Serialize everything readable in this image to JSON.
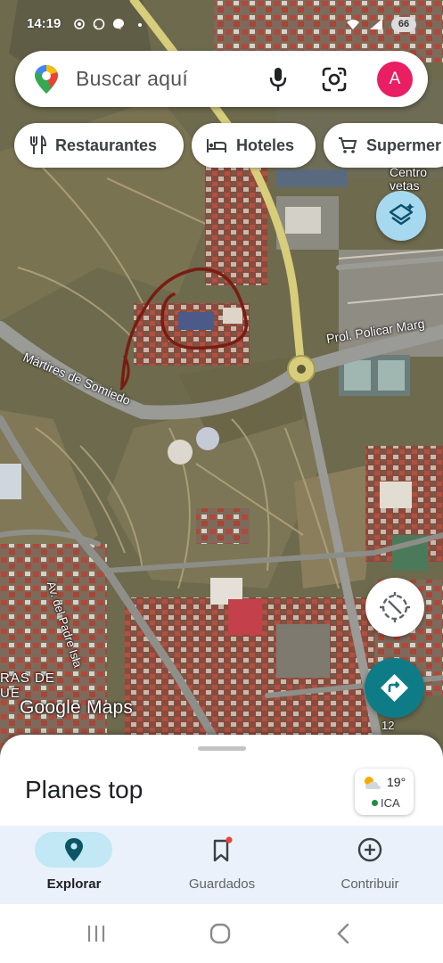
{
  "status_bar": {
    "time": "14:19",
    "battery": "66"
  },
  "search": {
    "placeholder": "Buscar aquí",
    "avatar_initial": "A"
  },
  "chips": [
    {
      "label": "Restaurantes",
      "icon": "fork-knife-icon"
    },
    {
      "label": "Hoteles",
      "icon": "bed-icon"
    },
    {
      "label": "Supermer",
      "icon": "cart-icon"
    }
  ],
  "map": {
    "attribution": "Google Maps",
    "labels": {
      "road_martires": "Mártires de Somiedo",
      "road_policar": "Prol. Policar Marg",
      "road_padre": "Av. del Padre Isla",
      "poi_centro": "Centro\nvetas",
      "area": "RAS DE\nUE",
      "number": "12"
    }
  },
  "bottom_sheet": {
    "title": "Planes top",
    "weather": {
      "temperature": "19°",
      "aqi": "ICA"
    }
  },
  "nav": {
    "items": [
      {
        "label": "Explorar",
        "icon": "location-pin-icon",
        "active": true
      },
      {
        "label": "Guardados",
        "icon": "bookmark-icon",
        "active": false
      },
      {
        "label": "Contribuir",
        "icon": "add-circle-icon",
        "active": false
      }
    ]
  },
  "colors": {
    "accent_teal": "#0e7c86",
    "avatar_pink": "#e91e63",
    "nav_bg": "#eaf1fb",
    "nav_active_pill": "#c2e7f5",
    "layers_button": "#a6d9ef"
  }
}
